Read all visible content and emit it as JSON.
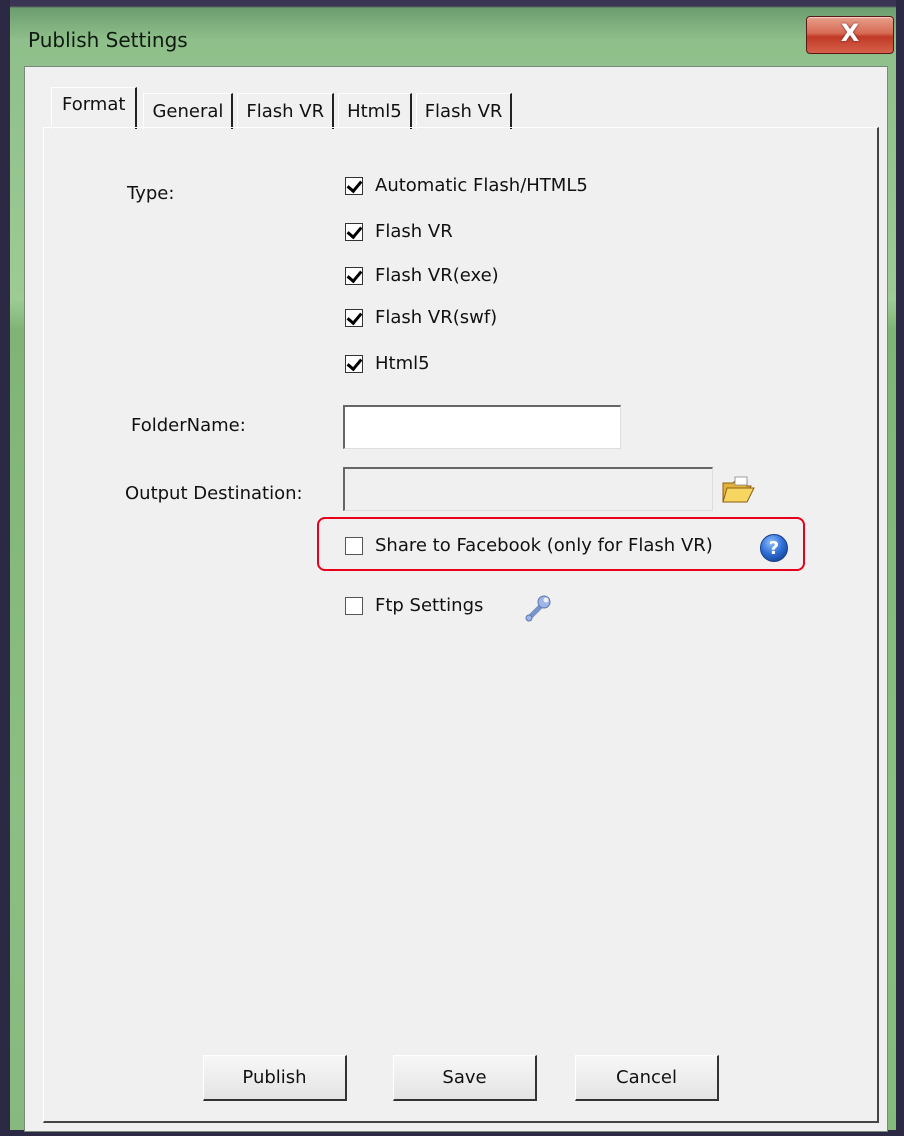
{
  "window": {
    "title": "Publish Settings",
    "close_label": "X"
  },
  "tabs": [
    {
      "label": "Format",
      "active": true
    },
    {
      "label": "General",
      "active": false
    },
    {
      "label": "Flash VR",
      "active": false
    },
    {
      "label": "Html5",
      "active": false
    },
    {
      "label": "Flash VR",
      "active": false
    }
  ],
  "type_section": {
    "label": "Type:",
    "options": [
      {
        "label": "Automatic Flash/HTML5",
        "checked": true
      },
      {
        "label": "Flash VR",
        "checked": true
      },
      {
        "label": "Flash VR(exe)",
        "checked": true
      },
      {
        "label": "Flash VR(swf)",
        "checked": true
      },
      {
        "label": "Html5",
        "checked": true
      }
    ]
  },
  "folder_name": {
    "label": "FolderName:",
    "value": ""
  },
  "output_destination": {
    "label": "Output Destination:",
    "value": ""
  },
  "share_facebook": {
    "label": "Share to Facebook (only for Flash VR)",
    "checked": false
  },
  "ftp_settings": {
    "label": "Ftp Settings",
    "checked": false
  },
  "buttons": {
    "publish": "Publish",
    "save": "Save",
    "cancel": "Cancel"
  },
  "colors": {
    "highlight": "#e8001a",
    "dialog_bg": "#f0f0f0",
    "frame_green": "#9ccb93",
    "help_blue": "#2f6fd6"
  },
  "icons": {
    "folder": "open-folder-icon",
    "help": "help-icon",
    "wrench": "wrench-icon",
    "close": "close-icon"
  }
}
